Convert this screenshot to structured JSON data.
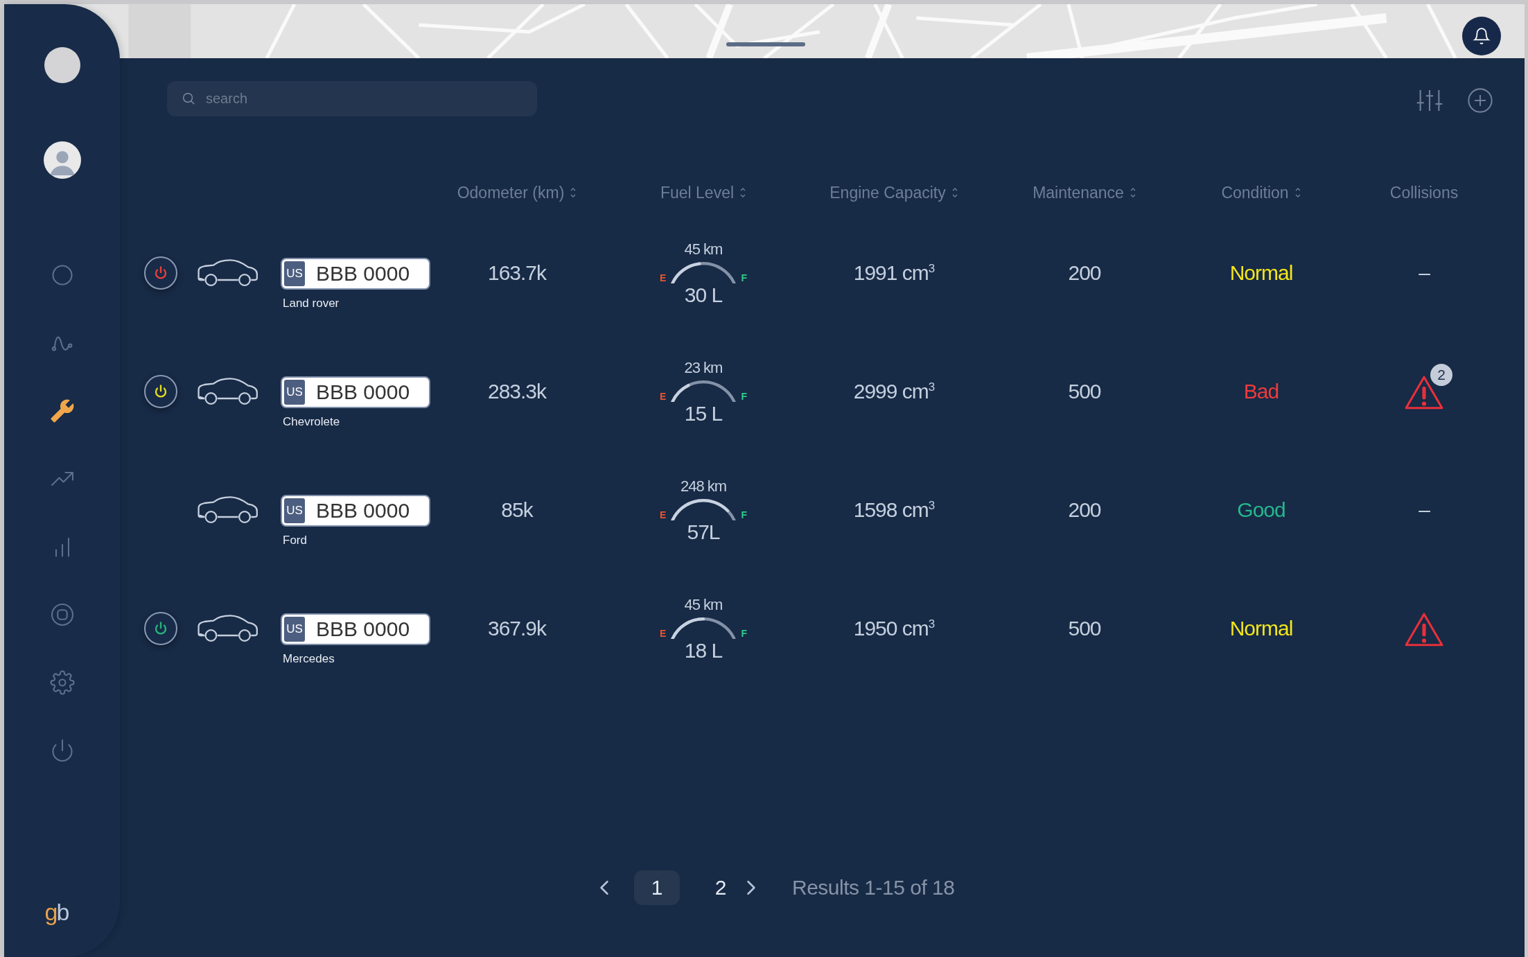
{
  "sidebar": {
    "nav": [
      {
        "kind": "circle",
        "selected": false
      },
      {
        "kind": "wave",
        "selected": false
      },
      {
        "kind": "wrench",
        "selected": true
      },
      {
        "kind": "trend",
        "selected": false
      },
      {
        "kind": "bars",
        "selected": false
      },
      {
        "kind": "target",
        "selected": false
      },
      {
        "kind": "gear",
        "selected": false
      },
      {
        "kind": "power",
        "selected": false
      }
    ],
    "brand": "gb"
  },
  "search": {
    "placeholder": "search"
  },
  "table": {
    "columns": [
      {
        "label": "Odometer (km)",
        "sortable": true
      },
      {
        "label": "Fuel Level",
        "sortable": true
      },
      {
        "label": "Engine Capacity",
        "sortable": true
      },
      {
        "label": "Maintenance",
        "sortable": true
      },
      {
        "label": "Condition",
        "sortable": true
      },
      {
        "label": "Collisions",
        "sortable": false
      }
    ],
    "rows": [
      {
        "engine_button": {
          "color": "#e8403a"
        },
        "plate": {
          "country": "US",
          "number": "BBB 0000"
        },
        "model": "Land rover",
        "odometer": "163.7k",
        "fuel": {
          "distance": "45 km",
          "amount": "30 L",
          "empty_label": "E",
          "full_label": "F",
          "level": 0.45
        },
        "engine": "1991 cm$^{3}$",
        "maintenance": "200",
        "condition": {
          "text": "Normal",
          "color": "#f5e61a"
        },
        "collisions": {
          "kind": "none",
          "text": "–"
        }
      },
      {
        "engine_button": {
          "color": "#e8dd1f"
        },
        "plate": {
          "country": "US",
          "number": "BBB 0000"
        },
        "model": "Chevrolete",
        "odometer": "283.3k",
        "fuel": {
          "distance": "23 km",
          "amount": "15 L",
          "empty_label": "E",
          "full_label": "F",
          "level": 0.3
        },
        "engine": "2999 cm$^{3}$",
        "maintenance": "500",
        "condition": {
          "text": "Bad",
          "color": "#ef3b3b"
        },
        "collisions": {
          "kind": "alert",
          "count": "2"
        }
      },
      {
        "plate": {
          "country": "US",
          "number": "BBB 0000"
        },
        "model": "Ford",
        "odometer": "85k",
        "fuel": {
          "distance": "248 km",
          "amount": "57L",
          "empty_label": "E",
          "full_label": "F",
          "level": 0.85
        },
        "engine": "1598 cm$^{3}$",
        "maintenance": "200",
        "condition": {
          "text": "Good",
          "color": "#25b88e"
        },
        "collisions": {
          "kind": "none",
          "text": "–"
        }
      },
      {
        "engine_button": {
          "color": "#27b57c"
        },
        "plate": {
          "country": "US",
          "number": "BBB 0000"
        },
        "model": "Mercedes",
        "odometer": "367.9k",
        "fuel": {
          "distance": "45 km",
          "amount": "18 L",
          "empty_label": "E",
          "full_label": "F",
          "level": 0.5
        },
        "engine": "1950 cm$^{3}$",
        "maintenance": "500",
        "condition": {
          "text": "Normal",
          "color": "#f5e61a"
        },
        "collisions": {
          "kind": "alert"
        }
      }
    ]
  },
  "pagination": {
    "pages": [
      {
        "label": "1",
        "selected": true
      },
      {
        "label": "2",
        "selected": false
      }
    ],
    "results": "Results 1-15 of 18"
  }
}
